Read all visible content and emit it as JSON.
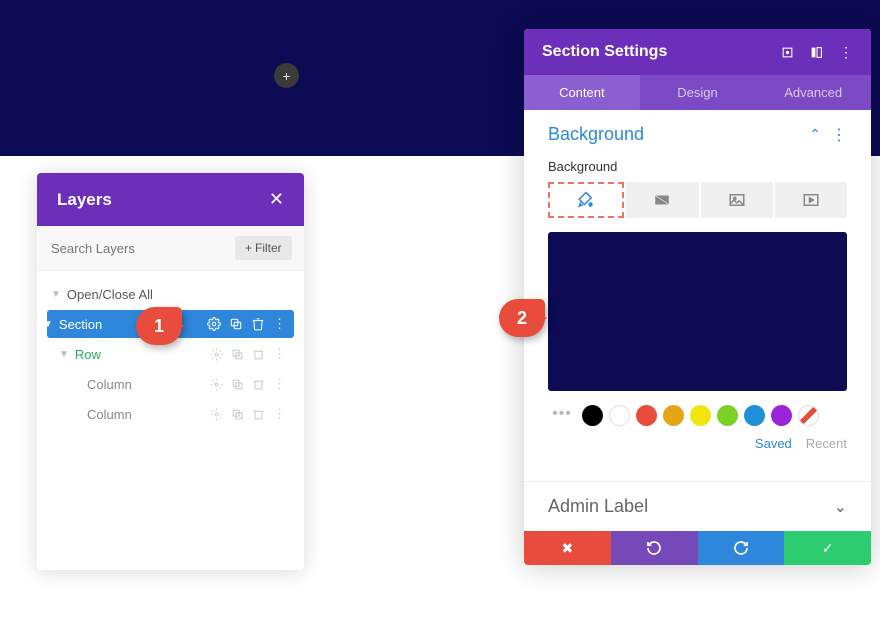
{
  "layers": {
    "title": "Layers",
    "search_placeholder": "Search Layers",
    "filter_label": "Filter",
    "open_close": "Open/Close All",
    "items": [
      {
        "label": "Section",
        "type": "section"
      },
      {
        "label": "Row",
        "type": "row"
      },
      {
        "label": "Column",
        "type": "column"
      },
      {
        "label": "Column",
        "type": "column"
      }
    ]
  },
  "settings": {
    "title": "Section Settings",
    "tabs": {
      "content": "Content",
      "design": "Design",
      "advanced": "Advanced"
    },
    "background": {
      "section_title": "Background",
      "label": "Background",
      "preview_color": "#0c0b53",
      "swatches": [
        "#000000",
        "#ffffff",
        "#e74c3c",
        "#e6a417",
        "#f1e40f",
        "#7bd124",
        "#1f8fd8",
        "#9b24d8"
      ],
      "saved": "Saved",
      "recent": "Recent"
    },
    "admin_label": "Admin Label"
  },
  "callouts": {
    "one": "1",
    "two": "2"
  }
}
